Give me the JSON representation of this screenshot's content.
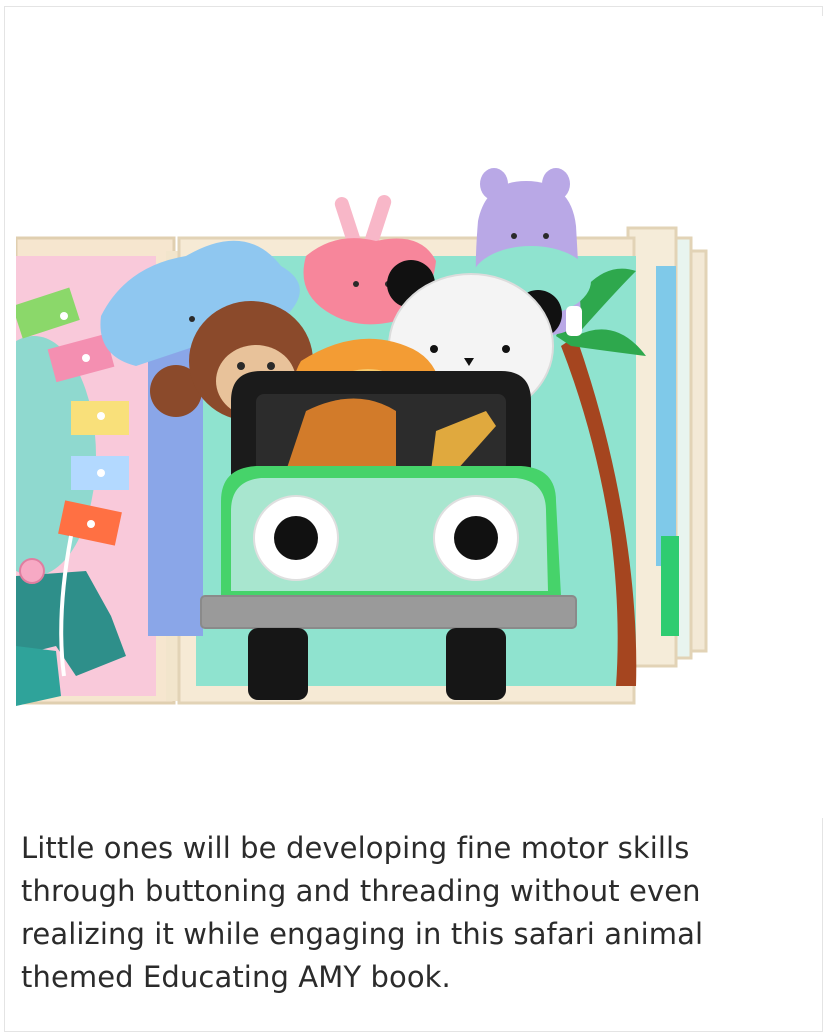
{
  "photo": {
    "subject": "felt quiet book page with safari animals in a mint green jeep",
    "colors": {
      "background": "#ffffff",
      "jeep_body": "#a8e6cf",
      "page_mint": "#8fe3cf",
      "pink_page": "#f7c6d9",
      "hippo_purple": "#b9a8e6",
      "panda_white": "#f4f4f4",
      "lion_orange": "#f39c34",
      "monkey_brown": "#8b4a2b",
      "giraffe_pink": "#f7869b",
      "elephant_blue": "#8fc7f0"
    }
  },
  "caption": {
    "text": "Little ones will be developing fine motor skills through buttoning and threading without even realizing it while engaging in this safari animal themed Educating AMY book."
  }
}
